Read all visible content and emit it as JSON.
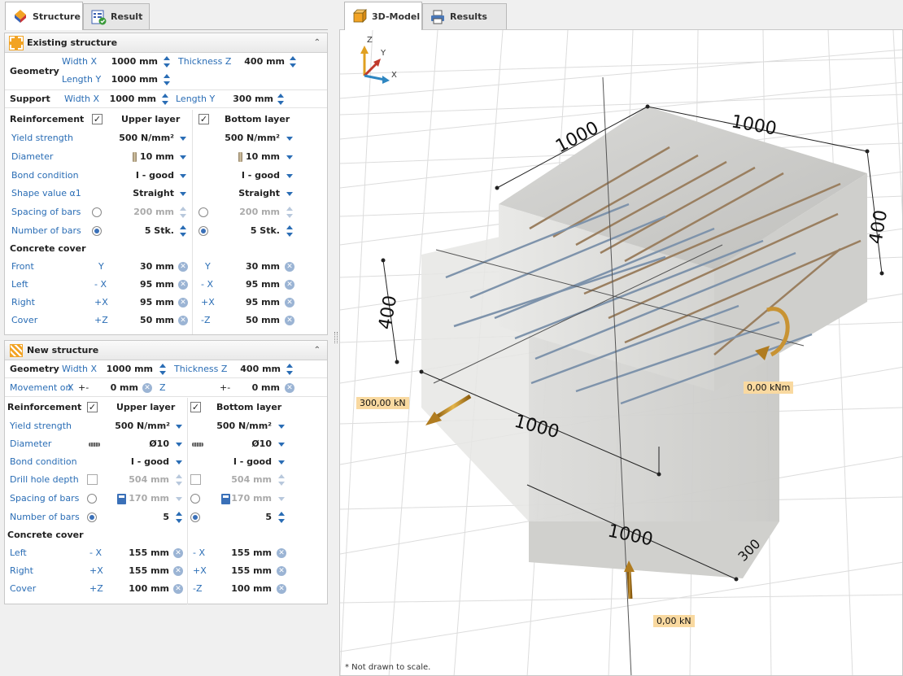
{
  "left_tabs": [
    {
      "label": "Structure",
      "active": true
    },
    {
      "label": "Result",
      "active": false
    }
  ],
  "right_tabs": [
    {
      "label": "3D-Model",
      "active": true
    },
    {
      "label": "Results",
      "active": false
    }
  ],
  "existing": {
    "title": "Existing structure",
    "geometry": {
      "label": "Geometry",
      "width_x_label": "Width X",
      "width_x": "1000 mm",
      "thickness_z_label": "Thickness Z",
      "thickness_z": "400 mm",
      "length_y_label": "Length Y",
      "length_y": "1000 mm"
    },
    "support": {
      "label": "Support",
      "width_x_label": "Width X",
      "width_x": "1000 mm",
      "length_y_label": "Length Y",
      "length_y": "300 mm"
    },
    "reinforcement": {
      "label": "Reinforcement",
      "upper": "Upper layer",
      "bottom": "Bottom layer",
      "yield_label": "Yield strength",
      "yield_u": "500 N/mm²",
      "yield_b": "500 N/mm²",
      "diam_label": "Diameter",
      "diam_u": "10 mm",
      "diam_b": "10 mm",
      "bond_label": "Bond condition",
      "bond_u": "I - good",
      "bond_b": "I - good",
      "shape_label": "Shape value α1",
      "shape_u": "Straight",
      "shape_b": "Straight",
      "spacing_label": "Spacing of bars",
      "spacing_u": "200 mm",
      "spacing_b": "200 mm",
      "number_label": "Number of bars",
      "number_u": "5 Stk.",
      "number_b": "5 Stk."
    },
    "cover": {
      "label": "Concrete cover",
      "front_label": "Front",
      "front_u_axis": "Y",
      "front_u": "30 mm",
      "front_b_axis": "Y",
      "front_b": "30 mm",
      "left_label": "Left",
      "left_u_axis": "- X",
      "left_u": "95 mm",
      "left_b_axis": "- X",
      "left_b": "95 mm",
      "right_label": "Right",
      "right_u_axis": "+X",
      "right_u": "95 mm",
      "right_b_axis": "+X",
      "right_b": "95 mm",
      "cover_label": "Cover",
      "cover_u_axis": "+Z",
      "cover_u": "50 mm",
      "cover_b_axis": "-Z",
      "cover_b": "50 mm"
    }
  },
  "newst": {
    "title": "New structure",
    "geometry": {
      "label": "Geometry",
      "width_x_label": "Width X",
      "width_x": "1000 mm",
      "thickness_z_label": "Thickness Z",
      "thickness_z": "400 mm"
    },
    "movement": {
      "label": "Movement on",
      "x_label": "X",
      "x_sign": "+-",
      "x": "0 mm",
      "z_label": "Z",
      "z_sign": "+-",
      "z": "0 mm"
    },
    "reinforcement": {
      "label": "Reinforcement",
      "upper": "Upper layer",
      "bottom": "Bottom layer",
      "yield_label": "Yield strength",
      "yield_u": "500 N/mm²",
      "yield_b": "500 N/mm²",
      "diam_label": "Diameter",
      "diam_u": "Ø10",
      "diam_b": "Ø10",
      "bond_label": "Bond condition",
      "bond_u": "I - good",
      "bond_b": "I - good",
      "drill_label": "Drill hole depth",
      "drill_u": "504 mm",
      "drill_b": "504 mm",
      "spacing_label": "Spacing of bars",
      "spacing_u": "170 mm",
      "spacing_b": "170 mm",
      "number_label": "Number of bars",
      "number_u": "5",
      "number_b": "5"
    },
    "cover": {
      "label": "Concrete cover",
      "left_label": "Left",
      "left_u_axis": "- X",
      "left_u": "155 mm",
      "left_b_axis": "- X",
      "left_b": "155 mm",
      "right_label": "Right",
      "right_u_axis": "+X",
      "right_u": "155 mm",
      "right_b_axis": "+X",
      "right_b": "155 mm",
      "cover_label": "Cover",
      "cover_u_axis": "+Z",
      "cover_u": "100 mm",
      "cover_b_axis": "-Z",
      "cover_b": "100 mm"
    }
  },
  "model": {
    "axes": {
      "x": "X",
      "y": "Y",
      "z": "Z"
    },
    "dims": {
      "top_length": "1000",
      "top_width": "1000",
      "height_right": "400",
      "height_left": "400",
      "lower_width": "1000",
      "lower_length": "1000",
      "lower_depth": "300"
    },
    "loads": {
      "horizontal": "300,00 kN",
      "moment": "0,00 kNm",
      "vertical": "0,00 kN"
    },
    "note": "* Not drawn to scale."
  }
}
